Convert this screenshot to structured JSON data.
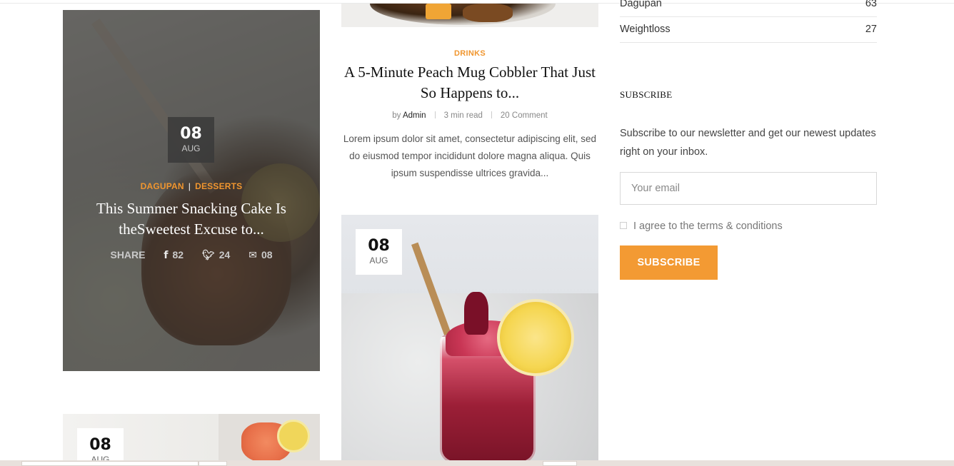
{
  "sidebar": {
    "categories": [
      {
        "name": "Dagupan",
        "count": "63"
      },
      {
        "name": "Weightloss",
        "count": "27"
      }
    ],
    "subscribe": {
      "title": "SUBSCRIBE",
      "description": "Subscribe to our newsletter and get our newest updates right on your inbox.",
      "email_placeholder": "Your email",
      "agree_label": "I agree to the terms & conditions",
      "button_label": "SUBSCRIBE"
    }
  },
  "featured_post": {
    "date_day": "08",
    "date_month": "AUG",
    "categories": [
      "DAGUPAN",
      "DESSERTS"
    ],
    "separator": "|",
    "title": "This Summer Snacking Cake Is theSweetest Excuse to...",
    "share_label": "SHARE",
    "facebook_count": "82",
    "twitter_count": "24",
    "email_count": "08"
  },
  "post_drinks": {
    "category": "DRINKS",
    "title": "A 5-Minute Peach Mug Cobbler That Just So Happens to...",
    "by_label": "by",
    "author": "Admin",
    "read_time": "3 min read",
    "comments": "20 Comment",
    "excerpt": "Lorem ipsum dolor sit amet, consectetur adipiscing elit, sed do eiusmod tempor incididunt dolore magna aliqua. Quis ipsum suspendisse ultrices gravida..."
  },
  "post_drink_image": {
    "date_day": "08",
    "date_month": "AUG"
  },
  "post_bottom_left": {
    "date_day": "08",
    "date_month": "AUG"
  },
  "colors": {
    "accent": "#f39a33",
    "category": "#f0962f"
  },
  "icons": [
    "facebook-icon",
    "twitter-icon",
    "envelope-icon"
  ]
}
